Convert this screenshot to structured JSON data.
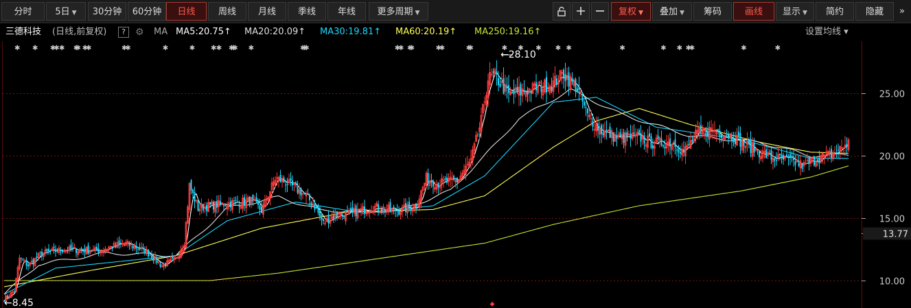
{
  "toolbar": {
    "left": [
      {
        "label": "分时",
        "caret": false,
        "active": false
      },
      {
        "label": "5日",
        "caret": true,
        "active": false
      },
      {
        "label": "30分钟",
        "caret": false,
        "active": false
      },
      {
        "label": "60分钟",
        "caret": false,
        "active": false
      },
      {
        "label": "日线",
        "caret": false,
        "active": true
      },
      {
        "label": "周线",
        "caret": false,
        "active": false
      },
      {
        "label": "月线",
        "caret": false,
        "active": false
      },
      {
        "label": "季线",
        "caret": false,
        "active": false
      },
      {
        "label": "年线",
        "caret": false,
        "active": false
      },
      {
        "label": "更多周期",
        "caret": true,
        "active": false
      }
    ],
    "right": [
      {
        "label": "复权",
        "caret": true,
        "active": true
      },
      {
        "label": "叠加",
        "caret": true,
        "active": false
      },
      {
        "label": "筹码",
        "caret": false,
        "active": false
      },
      {
        "label": "画线",
        "caret": false,
        "active": true
      },
      {
        "label": "显示",
        "caret": true,
        "active": false
      },
      {
        "label": "简约",
        "caret": false,
        "active": false
      },
      {
        "label": "隐藏",
        "caret": false,
        "active": false
      }
    ],
    "icons": {
      "lock": "lock-icon",
      "zoom_in": "+",
      "zoom_out": "−",
      "collapse": "»"
    }
  },
  "stock": {
    "name": "三德科技",
    "mode": "(日线,前复权)",
    "help": "?",
    "ma_label": "MA",
    "ma": [
      {
        "text": "MA5:20.75",
        "arrow": "↑",
        "color": "#ffffff"
      },
      {
        "text": "MA20:20.09",
        "arrow": "↑",
        "color": "#e0e0e0"
      },
      {
        "text": "MA30:19.81",
        "arrow": "↑",
        "color": "#19d9ff"
      },
      {
        "text": "MA60:20.19",
        "arrow": "↑",
        "color": "#ffff55"
      },
      {
        "text": "MA250:19.16",
        "arrow": "↑",
        "color": "#c8e632"
      }
    ],
    "settings": "设置均线"
  },
  "chart_data": {
    "type": "candlestick",
    "y_ticks": [
      "25.00",
      "20.00",
      "15.00",
      "10.00"
    ],
    "current_price": "13.77",
    "high_mark": "28.10",
    "low_mark": "8.45",
    "ylim": [
      7.8,
      29.2
    ],
    "colors": {
      "up": "#ff3b3b",
      "down": "#19d9ff",
      "ma5": "#ffffff",
      "ma20": "#e0e0e0",
      "ma30": "#19d9ff",
      "ma60": "#ffff55",
      "ma250": "#c8e632",
      "grid": "#7a1414"
    },
    "closes_anchor": [
      [
        0,
        8.5
      ],
      [
        6,
        9.2
      ],
      [
        9,
        11.8
      ],
      [
        14,
        11.2
      ],
      [
        22,
        12.2
      ],
      [
        35,
        12.5
      ],
      [
        55,
        12.4
      ],
      [
        70,
        13.0
      ],
      [
        82,
        12.4
      ],
      [
        92,
        11.2
      ],
      [
        100,
        11.7
      ],
      [
        105,
        13.1
      ],
      [
        108,
        17.6
      ],
      [
        113,
        15.8
      ],
      [
        120,
        16.0
      ],
      [
        132,
        16.2
      ],
      [
        144,
        16.4
      ],
      [
        150,
        15.6
      ],
      [
        158,
        18.2
      ],
      [
        164,
        17.9
      ],
      [
        174,
        17.0
      ],
      [
        180,
        16.2
      ],
      [
        186,
        14.6
      ],
      [
        192,
        15.2
      ],
      [
        200,
        15.3
      ],
      [
        215,
        15.9
      ],
      [
        230,
        15.6
      ],
      [
        240,
        16.0
      ],
      [
        246,
        18.2
      ],
      [
        252,
        17.8
      ],
      [
        264,
        18.0
      ],
      [
        272,
        19.6
      ],
      [
        278,
        22.8
      ],
      [
        282,
        26.2
      ],
      [
        286,
        26.4
      ],
      [
        294,
        24.9
      ],
      [
        306,
        25.3
      ],
      [
        320,
        25.8
      ],
      [
        326,
        26.6
      ],
      [
        334,
        25.4
      ],
      [
        340,
        23.2
      ],
      [
        348,
        22.0
      ],
      [
        358,
        21.4
      ],
      [
        370,
        21.5
      ],
      [
        378,
        21.0
      ],
      [
        390,
        21.1
      ],
      [
        396,
        20.3
      ],
      [
        404,
        21.8
      ],
      [
        412,
        22.1
      ],
      [
        424,
        21.6
      ],
      [
        432,
        20.9
      ],
      [
        446,
        19.9
      ],
      [
        458,
        19.6
      ],
      [
        466,
        19.2
      ],
      [
        474,
        19.8
      ],
      [
        484,
        20.2
      ],
      [
        492,
        21.1
      ]
    ],
    "ma_anchor": {
      "ma20": [
        [
          0,
          8.9
        ],
        [
          20,
          11.3
        ],
        [
          60,
          12.2
        ],
        [
          100,
          12.0
        ],
        [
          108,
          13.0
        ],
        [
          130,
          15.8
        ],
        [
          160,
          16.7
        ],
        [
          185,
          15.6
        ],
        [
          230,
          15.6
        ],
        [
          260,
          17.2
        ],
        [
          280,
          20.0
        ],
        [
          300,
          23.0
        ],
        [
          330,
          25.3
        ],
        [
          360,
          23.3
        ],
        [
          400,
          21.6
        ],
        [
          440,
          21.1
        ],
        [
          470,
          20.0
        ],
        [
          492,
          20.1
        ]
      ],
      "ma30": [
        [
          0,
          8.9
        ],
        [
          30,
          11.0
        ],
        [
          100,
          12.0
        ],
        [
          130,
          14.8
        ],
        [
          170,
          16.3
        ],
        [
          210,
          15.4
        ],
        [
          250,
          16.0
        ],
        [
          280,
          18.4
        ],
        [
          320,
          24.3
        ],
        [
          345,
          24.7
        ],
        [
          380,
          22.3
        ],
        [
          430,
          21.3
        ],
        [
          470,
          19.8
        ],
        [
          492,
          19.8
        ]
      ],
      "ma60": [
        [
          0,
          9.5
        ],
        [
          50,
          10.8
        ],
        [
          100,
          12.0
        ],
        [
          150,
          14.2
        ],
        [
          200,
          15.5
        ],
        [
          250,
          15.7
        ],
        [
          280,
          16.8
        ],
        [
          320,
          20.7
        ],
        [
          345,
          22.8
        ],
        [
          370,
          23.8
        ],
        [
          400,
          22.5
        ],
        [
          440,
          21.1
        ],
        [
          470,
          20.3
        ],
        [
          492,
          20.2
        ]
      ],
      "ma250": [
        [
          0,
          10.0
        ],
        [
          120,
          10.0
        ],
        [
          160,
          10.6
        ],
        [
          220,
          11.8
        ],
        [
          280,
          13.0
        ],
        [
          320,
          14.5
        ],
        [
          370,
          16.0
        ],
        [
          430,
          17.2
        ],
        [
          470,
          18.3
        ],
        [
          492,
          19.2
        ]
      ]
    }
  }
}
